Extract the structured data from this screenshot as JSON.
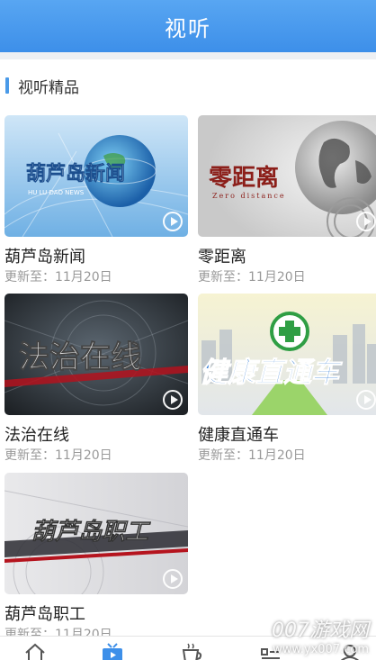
{
  "header": {
    "title": "视听"
  },
  "section": {
    "title": "视听精品"
  },
  "programs": [
    {
      "name": "葫芦岛新闻",
      "updated": "更新至：11月20日",
      "art_text": "葫芦岛新闻",
      "art_sub": "HU LU DAO NEWS"
    },
    {
      "name": "零距离",
      "updated": "更新至：11月20日",
      "art_text": "零距离",
      "art_sub": "Zero distance"
    },
    {
      "name": "法治在线",
      "updated": "更新至：11月20日",
      "art_text": "法治在线"
    },
    {
      "name": "健康直通车",
      "updated": "更新至：11月20日",
      "art_text": "健康直通车"
    },
    {
      "name": "葫芦岛职工",
      "updated": "更新至：11月20日",
      "art_text": "葫芦岛职工"
    }
  ],
  "tabbar": {
    "tabs": [
      {
        "icon": "home-icon"
      },
      {
        "icon": "tv-icon",
        "active": true
      },
      {
        "icon": "coffee-icon"
      },
      {
        "icon": "list-icon"
      },
      {
        "icon": "user-icon"
      }
    ],
    "active_color": "#3d8fe9"
  },
  "watermark": {
    "line1": "007游戏网",
    "line2": "www.yx007.com"
  },
  "colors": {
    "brand": "#3d8fe9",
    "accent_bar": "#4a9ae8"
  }
}
